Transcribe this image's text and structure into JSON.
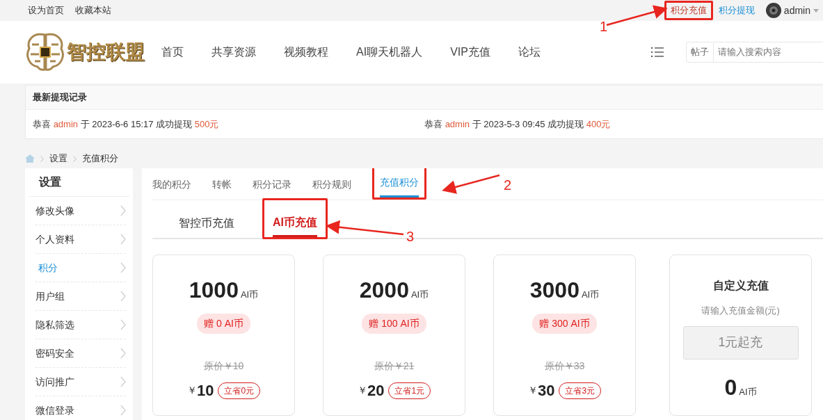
{
  "topbar": {
    "links": [
      {
        "label": "设为首页"
      },
      {
        "label": "收藏本站"
      }
    ],
    "user_links": [
      {
        "label": "积分充值",
        "kind": "active",
        "highlighted": true
      },
      {
        "label": "积分提现",
        "kind": "link",
        "highlighted": false
      }
    ],
    "user": {
      "name": "admin"
    }
  },
  "header": {
    "logo_text": "智控联盟",
    "nav": [
      {
        "label": "首页"
      },
      {
        "label": "共享资源"
      },
      {
        "label": "视频教程"
      },
      {
        "label": "AI聊天机器人"
      },
      {
        "label": "VIP充值"
      },
      {
        "label": "论坛"
      }
    ],
    "search": {
      "scope": "帖子",
      "placeholder": "请输入搜索内容"
    }
  },
  "notice": {
    "title": "最新提现记录",
    "items": [
      {
        "prefix": "恭喜",
        "user": "admin",
        "middle": "于 2023-6-6 15:17 成功提现",
        "amount": "500元"
      },
      {
        "prefix": "恭喜",
        "user": "admin",
        "middle": "于 2023-5-3 09:45 成功提现",
        "amount": "400元"
      }
    ]
  },
  "breadcrumb": [
    "设置",
    "充值积分"
  ],
  "sidebar": {
    "title": "设置",
    "items": [
      {
        "label": "修改头像",
        "selected": false
      },
      {
        "label": "个人资料",
        "selected": false
      },
      {
        "label": "积分",
        "selected": true
      },
      {
        "label": "用户组",
        "selected": false
      },
      {
        "label": "隐私筛选",
        "selected": false
      },
      {
        "label": "密码安全",
        "selected": false
      },
      {
        "label": "访问推广",
        "selected": false
      },
      {
        "label": "微信登录",
        "selected": false
      }
    ]
  },
  "tabs": [
    {
      "label": "我的积分",
      "selected": false,
      "highlighted": false
    },
    {
      "label": "转帐",
      "selected": false,
      "highlighted": false
    },
    {
      "label": "积分记录",
      "selected": false,
      "highlighted": false
    },
    {
      "label": "积分规则",
      "selected": false,
      "highlighted": false
    },
    {
      "label": "充值积分",
      "selected": true,
      "highlighted": true
    }
  ],
  "subtabs": [
    {
      "label": "智控币充值",
      "selected": false,
      "highlighted": false
    },
    {
      "label": "AI币充值",
      "selected": true,
      "highlighted": true
    }
  ],
  "packages": [
    {
      "amount": "1000",
      "unit": "AI币",
      "bonus": "赠 0 AI币",
      "original": "原价￥10",
      "currency": "￥",
      "price": "10",
      "save": "立省0元"
    },
    {
      "amount": "2000",
      "unit": "AI币",
      "bonus": "赠 100 AI币",
      "original": "原价￥21",
      "currency": "￥",
      "price": "20",
      "save": "立省1元"
    },
    {
      "amount": "3000",
      "unit": "AI币",
      "bonus": "赠 300 AI币",
      "original": "原价￥33",
      "currency": "￥",
      "price": "30",
      "save": "立省3元"
    }
  ],
  "custom": {
    "title": "自定义充值",
    "hint": "请输入充值金额(元)",
    "placeholder": "1元起充",
    "amount": "0",
    "unit": "AI币"
  },
  "annotations": [
    {
      "label": "1"
    },
    {
      "label": "2"
    },
    {
      "label": "3"
    }
  ]
}
